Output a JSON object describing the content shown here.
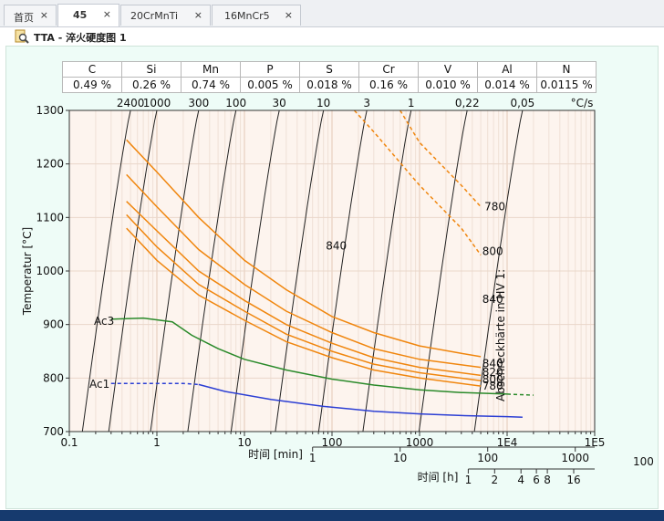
{
  "tabs": [
    {
      "label": "首页"
    },
    {
      "label": "45"
    },
    {
      "label": "20CrMnTi"
    },
    {
      "label": "16MnCr5"
    }
  ],
  "tab_close_glyph": "×",
  "icon": "document-magnifier-icon",
  "title": "TTA - 淬火硬度图 1",
  "composition": {
    "elements": [
      "C",
      "Si",
      "Mn",
      "P",
      "S",
      "Cr",
      "V",
      "Al",
      "N"
    ],
    "values": [
      "0.49 %",
      "0.26 %",
      "0.74 %",
      "0.005 %",
      "0.018 %",
      "0.16 %",
      "0.010 %",
      "0.014 %",
      "0.0115 %"
    ]
  },
  "chart_data": {
    "type": "line",
    "ylabel": "Temperatur [°C]",
    "ylim": [
      700,
      1300
    ],
    "yticks": [
      700,
      800,
      900,
      1000,
      1100,
      1200,
      1300
    ],
    "x_scale": "log",
    "xlim": [
      0.1,
      100000
    ],
    "xticks": [
      0.1,
      1,
      10,
      100,
      1000,
      10000,
      100000
    ],
    "xticklabels": [
      "0.1",
      "1",
      "10",
      "100",
      "1000",
      "1E4",
      "1E5"
    ],
    "xlabel": "时间 [min]",
    "min_ticks": [
      {
        "label": "1",
        "v": 60
      },
      {
        "label": "10",
        "v": 600
      },
      {
        "label": "100",
        "v": 6000
      },
      {
        "label": "1000",
        "v": 60000
      }
    ],
    "h_axis_label": "时间 [h]",
    "h_ticks": [
      {
        "label": "1",
        "v": 3600
      },
      {
        "label": "2",
        "v": 7200
      },
      {
        "label": "4",
        "v": 14400
      },
      {
        "label": "6",
        "v": 21600
      },
      {
        "label": "8",
        "v": 28800
      },
      {
        "label": "16",
        "v": 57600
      }
    ],
    "h_minor_label": "100",
    "h_minor_at": 360000,
    "cooling_rate_unit": "°C/s",
    "cooling_rates": [
      {
        "label": "2400",
        "top_time": 0.5
      },
      {
        "label": "1000",
        "top_time": 1.0
      },
      {
        "label": "300",
        "top_time": 3.0
      },
      {
        "label": "100",
        "top_time": 8.0
      },
      {
        "label": "30",
        "top_time": 25
      },
      {
        "label": "10",
        "top_time": 80
      },
      {
        "label": "3",
        "top_time": 250
      },
      {
        "label": "1",
        "top_time": 800
      },
      {
        "label": "0,22",
        "top_time": 3500
      },
      {
        "label": "0,05",
        "top_time": 15000
      }
    ],
    "phase_labels": {
      "ac3": "Ac3",
      "ac1": "Ac1"
    },
    "ac3_solid": [
      [
        0.3,
        910
      ],
      [
        0.7,
        912
      ],
      [
        1.5,
        905
      ],
      [
        2.5,
        880
      ],
      [
        5,
        855
      ],
      [
        10,
        835
      ],
      [
        30,
        815
      ],
      [
        100,
        798
      ],
      [
        300,
        787
      ],
      [
        1000,
        778
      ],
      [
        3000,
        773
      ],
      [
        10000,
        770
      ]
    ],
    "ac3_dashed": [
      [
        10000,
        770
      ],
      [
        20000,
        768
      ]
    ],
    "ac1_dashed": [
      [
        0.3,
        790
      ],
      [
        1.0,
        790
      ],
      [
        2.0,
        790
      ],
      [
        3.0,
        788
      ]
    ],
    "ac1_solid": [
      [
        3.0,
        788
      ],
      [
        6,
        775
      ],
      [
        20,
        760
      ],
      [
        80,
        747
      ],
      [
        300,
        738
      ],
      [
        1000,
        733
      ],
      [
        3000,
        730
      ],
      [
        10000,
        728
      ],
      [
        15000,
        727
      ]
    ],
    "austenitizing_curves": [
      {
        "label": "840",
        "points": [
          [
            0.45,
            1245
          ],
          [
            1,
            1185
          ],
          [
            3,
            1100
          ],
          [
            10,
            1020
          ],
          [
            30,
            965
          ],
          [
            100,
            915
          ],
          [
            300,
            885
          ],
          [
            1000,
            860
          ],
          [
            3000,
            846
          ],
          [
            5000,
            840
          ]
        ],
        "dashed": false
      },
      {
        "label": "840",
        "points": [
          [
            0.45,
            1180
          ],
          [
            1,
            1120
          ],
          [
            3,
            1040
          ],
          [
            10,
            975
          ],
          [
            30,
            925
          ],
          [
            100,
            885
          ],
          [
            300,
            855
          ],
          [
            1000,
            835
          ],
          [
            5000,
            820
          ]
        ],
        "dashed": false
      },
      {
        "label": "820",
        "points": [
          [
            0.45,
            1130
          ],
          [
            1,
            1075
          ],
          [
            3,
            1000
          ],
          [
            10,
            945
          ],
          [
            30,
            900
          ],
          [
            100,
            865
          ],
          [
            300,
            838
          ],
          [
            1000,
            820
          ],
          [
            5000,
            805
          ]
        ],
        "dashed": false
      },
      {
        "label": "800",
        "points": [
          [
            0.45,
            1105
          ],
          [
            1,
            1045
          ],
          [
            3,
            975
          ],
          [
            10,
            925
          ],
          [
            30,
            882
          ],
          [
            100,
            850
          ],
          [
            300,
            826
          ],
          [
            1000,
            810
          ],
          [
            5000,
            795
          ]
        ],
        "dashed": false
      },
      {
        "label": "780",
        "points": [
          [
            0.45,
            1080
          ],
          [
            1,
            1020
          ],
          [
            3,
            955
          ],
          [
            10,
            908
          ],
          [
            30,
            868
          ],
          [
            100,
            838
          ],
          [
            300,
            815
          ],
          [
            1000,
            800
          ],
          [
            5000,
            785
          ]
        ],
        "dashed": false
      },
      {
        "label": "800",
        "points": [
          [
            180,
            1300
          ],
          [
            300,
            1260
          ],
          [
            1000,
            1160
          ],
          [
            3000,
            1080
          ],
          [
            5000,
            1030
          ]
        ],
        "dashed": true
      },
      {
        "label": "780",
        "points": [
          [
            600,
            1300
          ],
          [
            1000,
            1240
          ],
          [
            3000,
            1160
          ],
          [
            5000,
            1120
          ]
        ],
        "dashed": true
      }
    ],
    "curve_labels": [
      {
        "text": "840",
        "t": 85,
        "T": 1040
      },
      {
        "text": "780",
        "t": 5500,
        "T": 1113
      },
      {
        "text": "800",
        "t": 5200,
        "T": 1030
      },
      {
        "text": "840",
        "t": 5200,
        "T": 940
      },
      {
        "text": "840",
        "t": 5200,
        "T": 820
      },
      {
        "text": "820",
        "t": 5200,
        "T": 804
      },
      {
        "text": "800",
        "t": 5200,
        "T": 790
      },
      {
        "text": "780",
        "t": 5200,
        "T": 778
      }
    ],
    "hardness_label": "Abschreckhärte in HV 1:"
  }
}
